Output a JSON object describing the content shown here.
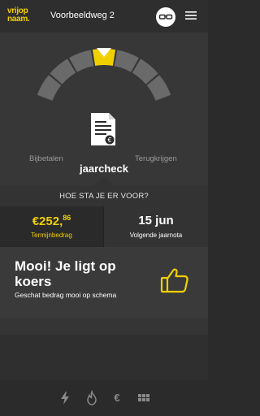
{
  "header": {
    "logo_line1": "vrijop",
    "logo_line2": "naam.",
    "address": "Voorbeeldweg 2",
    "glasses_icon": "glasses-icon",
    "menu_icon": "hamburger-menu-icon"
  },
  "gauge": {
    "left_label": "Bijbetalen",
    "right_label": "Terugkrijgen",
    "title": "jaarcheck",
    "document_icon": "document-euro-icon",
    "segments_total": 7,
    "active_segment": 4,
    "colors": {
      "active": "#f0d000",
      "inactive": "#6a6a6a"
    }
  },
  "question": {
    "text": "HOE STA JE ER VOOR?"
  },
  "stats": {
    "amount_main": "€252,",
    "amount_cents": "86",
    "amount_label": "Termijnbedrag",
    "date_value": "15 jun",
    "date_label": "Volgende jaarnota"
  },
  "message": {
    "title": "Mooi! Je ligt op koers",
    "subtitle": "Geschat bedrag mooi op schema",
    "icon": "thumbs-up-icon"
  },
  "bottom_nav": {
    "items": [
      {
        "icon": "lightning-icon"
      },
      {
        "icon": "flame-icon"
      },
      {
        "icon": "euro-icon",
        "glyph": "€"
      },
      {
        "icon": "grid-icon"
      }
    ]
  },
  "colors": {
    "accent": "#f0d000",
    "background": "#2b2b2b"
  }
}
